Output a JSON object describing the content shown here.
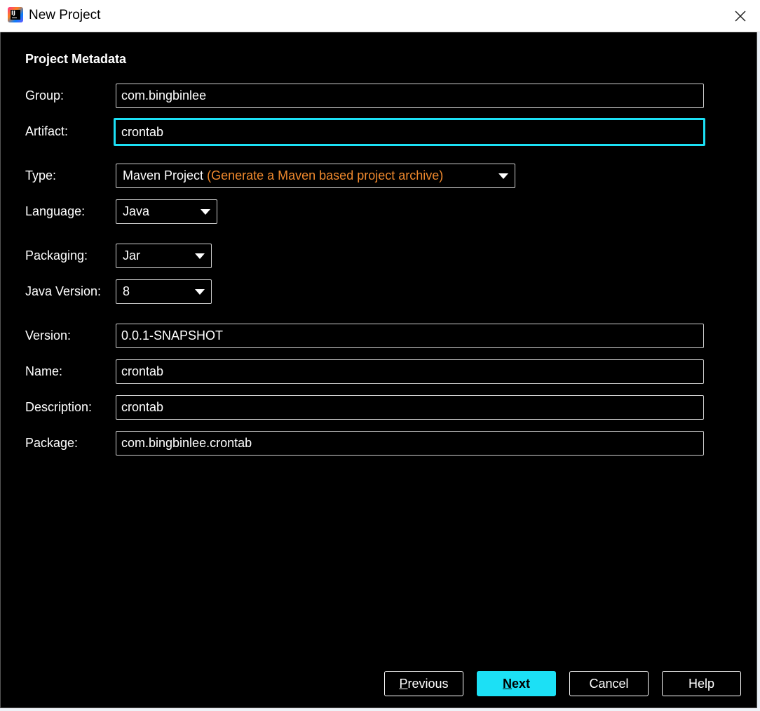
{
  "window": {
    "title": "New Project",
    "icon": "intellij-idea-icon"
  },
  "section_title": "Project Metadata",
  "fields": {
    "group": {
      "label": "Group:",
      "value": "com.bingbinlee"
    },
    "artifact": {
      "label": "Artifact:",
      "value": "crontab"
    },
    "type": {
      "label": "Type:",
      "value": "Maven Project",
      "hint": "(Generate a Maven based project archive)"
    },
    "language": {
      "label": "Language:",
      "value": "Java"
    },
    "packaging": {
      "label": "Packaging:",
      "value": "Jar"
    },
    "java_version": {
      "label": "Java Version:",
      "value": "8"
    },
    "version": {
      "label": "Version:",
      "value": "0.0.1-SNAPSHOT"
    },
    "name": {
      "label": "Name:",
      "value": "crontab"
    },
    "description": {
      "label": "Description:",
      "value": "crontab"
    },
    "package": {
      "label": "Package:",
      "value": "com.bingbinlee.crontab"
    }
  },
  "buttons": {
    "previous": {
      "mnemonic": "P",
      "rest": "revious"
    },
    "next": {
      "mnemonic": "N",
      "rest": "ext"
    },
    "cancel": "Cancel",
    "help": "Help"
  },
  "colors": {
    "background": "#000000",
    "focus_border": "#1ce0f5",
    "primary_button": "#1ce0f5",
    "hint_text": "#f0892d"
  }
}
